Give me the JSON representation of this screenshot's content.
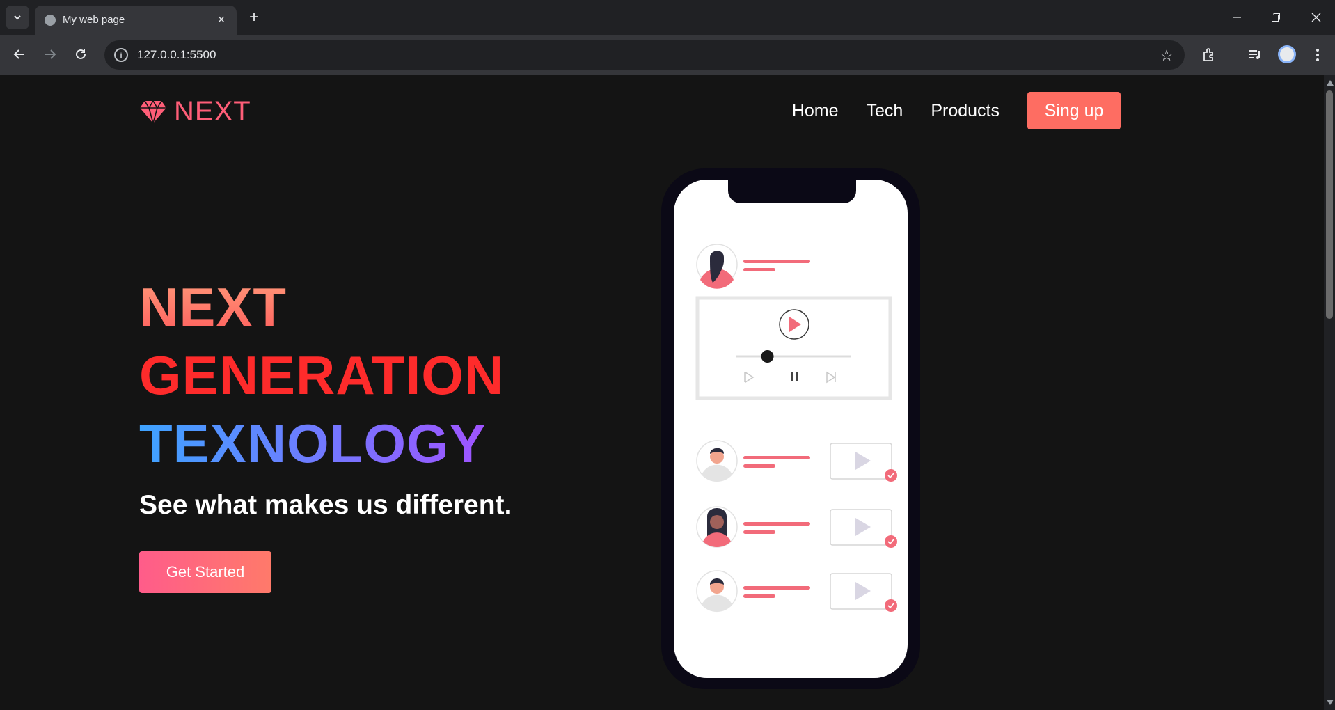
{
  "browser": {
    "tab_title": "My web page",
    "url": "127.0.0.1:5500"
  },
  "site": {
    "logo_text": "NEXT",
    "nav": [
      "Home",
      "Tech",
      "Products"
    ],
    "signup_label": "Sing up",
    "hero": {
      "line1": "NEXT",
      "line2": "GENERATION",
      "line3": "TEXNOLOGY",
      "subtitle": "See what makes us different.",
      "cta_label": "Get Started"
    }
  },
  "colors": {
    "brand": "#ff5e78",
    "signup_bg": "#fe6d62",
    "hero_red": "#fe2b2b"
  },
  "player": {
    "progress": 0.27
  }
}
